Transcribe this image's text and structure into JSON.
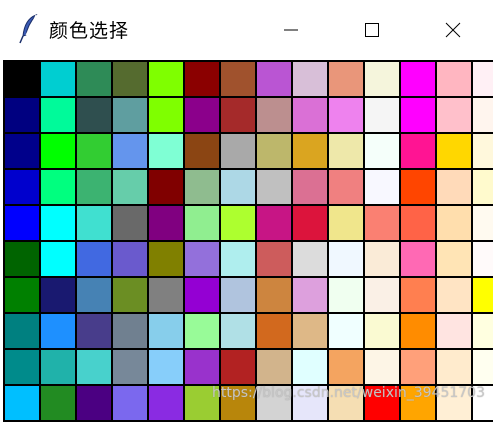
{
  "window": {
    "title": "颜色选择",
    "controls": [
      "minimize",
      "maximize",
      "close"
    ]
  },
  "app_icon": "feather-icon",
  "watermark": "https://blog.csdn.net/weixin_39451703",
  "palette": [
    [
      "#000000",
      "#00CED1",
      "#2E8B57",
      "#556B2F",
      "#7FFF00",
      "#8B0000",
      "#A0522D",
      "#BA55D3",
      "#D8BFD8",
      "#E9967A",
      "#F5F5DC",
      "#FF00FF",
      "#FFB6C1",
      "#FFF0F5"
    ],
    [
      "#000080",
      "#00FA9A",
      "#2F4F4F",
      "#5F9EA0",
      "#7FFF00",
      "#8B008B",
      "#A52A2A",
      "#BC8F8F",
      "#DA70D6",
      "#EE82EE",
      "#F5F5F5",
      "#FF00FF",
      "#FFC0CB",
      "#FFF5EE"
    ],
    [
      "#00008B",
      "#00FF00",
      "#32CD32",
      "#6495ED",
      "#7FFFD4",
      "#8B4513",
      "#A9A9A9",
      "#BDB76B",
      "#DAA520",
      "#EEE8AA",
      "#F5FFFA",
      "#FF1493",
      "#FFD700",
      "#FFF8DC"
    ],
    [
      "#0000CD",
      "#00FF7F",
      "#3CB371",
      "#66CDAA",
      "#800000",
      "#8FBC8F",
      "#ADD8E6",
      "#C0C0C0",
      "#DB7093",
      "#F08080",
      "#F8F8FF",
      "#FF4500",
      "#FFDAB9",
      "#FFFACD"
    ],
    [
      "#0000FF",
      "#00FFFF",
      "#40E0D0",
      "#696969",
      "#800080",
      "#90EE90",
      "#ADFF2F",
      "#C71585",
      "#DC143C",
      "#F0E68C",
      "#FA8072",
      "#FF6347",
      "#FFDEAD",
      "#FFFAF0"
    ],
    [
      "#006400",
      "#00FFFF",
      "#4169E1",
      "#6A5ACD",
      "#808000",
      "#9370DB",
      "#AFEEEE",
      "#CD5C5C",
      "#DCDCDC",
      "#F0F8FF",
      "#FAEBD7",
      "#FF69B4",
      "#FFE4B5",
      "#FFFAFA"
    ],
    [
      "#008000",
      "#191970",
      "#4682B4",
      "#6B8E23",
      "#808080",
      "#9400D3",
      "#B0C4DE",
      "#CD853F",
      "#DDA0DD",
      "#F0FFF0",
      "#FAF0E6",
      "#FF7F50",
      "#FFE4C4",
      "#FFFF00"
    ],
    [
      "#008080",
      "#1E90FF",
      "#483D8B",
      "#708090",
      "#87CEEB",
      "#98FB98",
      "#B0E0E6",
      "#D2691E",
      "#DEB887",
      "#F0FFFF",
      "#FAFAD2",
      "#FF8C00",
      "#FFE4E1",
      "#FFFFE0"
    ],
    [
      "#008B8B",
      "#20B2AA",
      "#48D1CC",
      "#778899",
      "#87CEFA",
      "#9932CC",
      "#B22222",
      "#D2B48C",
      "#E0FFFF",
      "#F4A460",
      "#FDF5E6",
      "#FFA07A",
      "#FFEBCD",
      "#FFFFF0"
    ],
    [
      "#00BFFF",
      "#228B22",
      "#4B0082",
      "#7B68EE",
      "#8A2BE2",
      "#9ACD32",
      "#B8860B",
      "#D3D3D3",
      "#E6E6FA",
      "#F5DEB3",
      "#FF0000",
      "#FFA500",
      "#FFEFD5",
      "#FFFFFF"
    ]
  ]
}
